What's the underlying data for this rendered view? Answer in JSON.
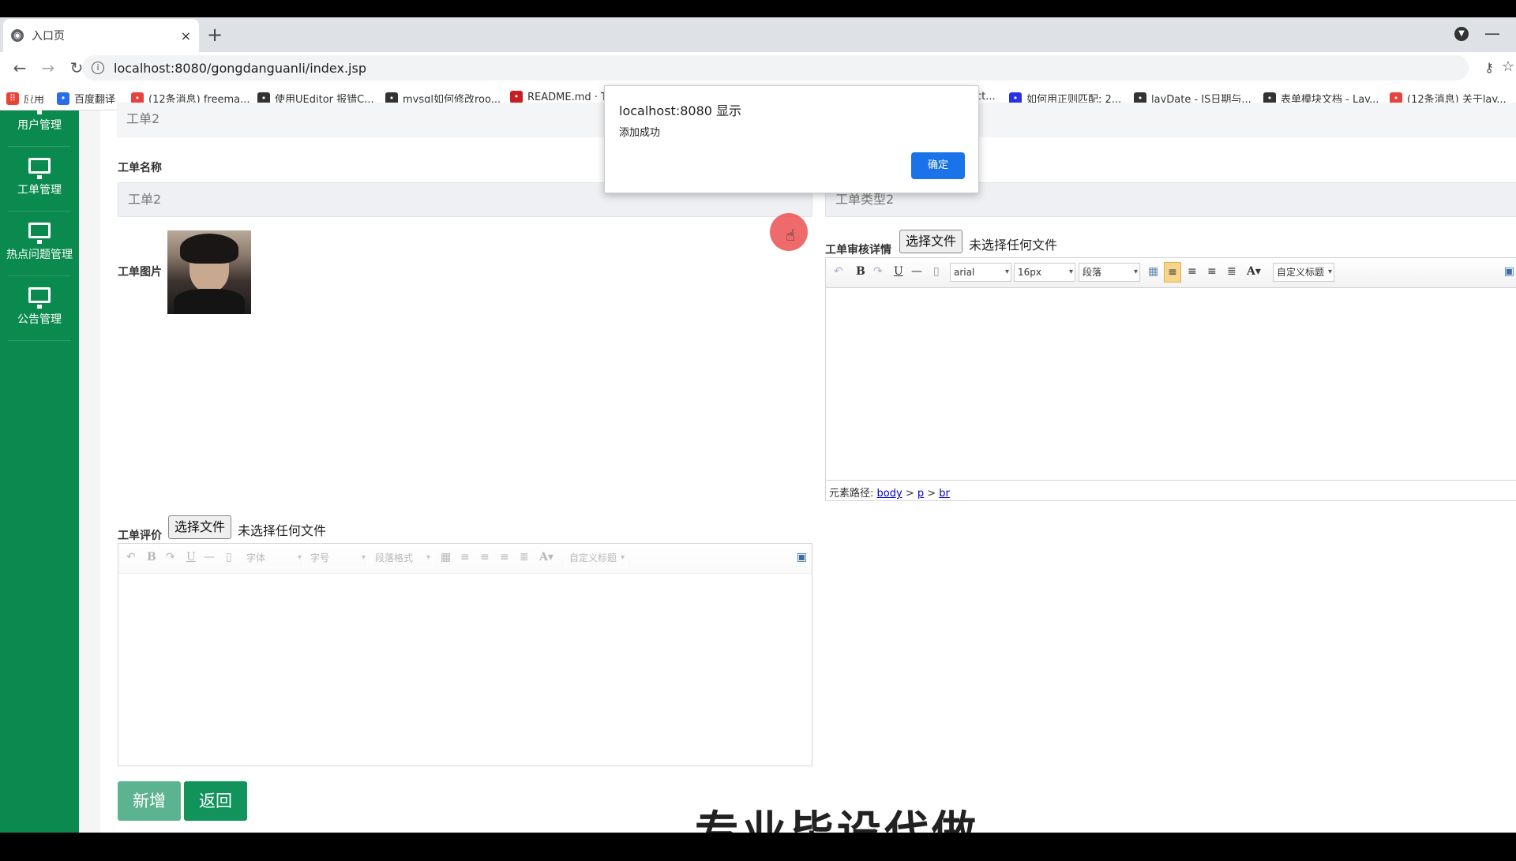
{
  "browser": {
    "tab_title": "入口页",
    "tab_close": "×",
    "new_tab": "+",
    "url": "localhost:8080/gongdanguanli/index.jsp",
    "bookmarks": [
      {
        "label": "应用",
        "icon": "apps-icon",
        "color": "#ea4335"
      },
      {
        "label": "百度翻译",
        "icon": "baidu-translate-icon",
        "color": "#2b6de8"
      },
      {
        "label": "(12条消息) freema...",
        "icon": "csdn-icon",
        "color": "#e8423d"
      },
      {
        "label": "使用UEditor 报错C...",
        "icon": "site-icon",
        "color": "#333333"
      },
      {
        "label": "mysql如何修改roo...",
        "icon": "site-icon",
        "color": "#333333"
      },
      {
        "label": "README.md · T",
        "icon": "gitee-icon",
        "color": "#c71d23"
      },
      {
        "label": "ct...",
        "icon": "none",
        "color": "#333333"
      },
      {
        "label": "如何用正则匹配: 2...",
        "icon": "baidu-paw-icon",
        "color": "#2932e1"
      },
      {
        "label": "layDate - JS日期与...",
        "icon": "layui-icon",
        "color": "#333333"
      },
      {
        "label": "表单模块文档 - Lay...",
        "icon": "layui-icon",
        "color": "#333333"
      },
      {
        "label": "(12条消息) 关于lay...",
        "icon": "csdn-icon",
        "color": "#e8423d"
      }
    ]
  },
  "sidebar": {
    "items": [
      {
        "label": "用户管理"
      },
      {
        "label": "工单管理"
      },
      {
        "label": "热点问题管理"
      },
      {
        "label": "公告管理"
      }
    ]
  },
  "form": {
    "top_field_value": "工单2",
    "name_label": "工单名称",
    "name_value": "工单2",
    "type_value": "工单类型2",
    "image_label": "工单图片",
    "review_label": "工单审核详情",
    "file_button": "选择文件",
    "file_status": "未选择任何文件",
    "comment_label": "工单评价",
    "review_toolbar": {
      "font": "arial",
      "size": "16px",
      "para": "段落",
      "custom": "自定义标题"
    },
    "comment_toolbar": {
      "font": "字体",
      "size": "字号",
      "para": "段落格式",
      "custom": "自定义标题"
    },
    "path_label": "元素路径:",
    "path": [
      "body",
      "p",
      "br"
    ],
    "add_button": "新增",
    "back_button": "返回"
  },
  "alert": {
    "title": "localhost:8080 显示",
    "message": "添加成功",
    "ok": "确定"
  },
  "overlay": {
    "subtitle": "专业毕设代做"
  },
  "colors": {
    "sidebar": "#0a8a4e",
    "accent": "#1a73e8",
    "button_add": "#5cb38f",
    "button_back": "#12935c"
  }
}
